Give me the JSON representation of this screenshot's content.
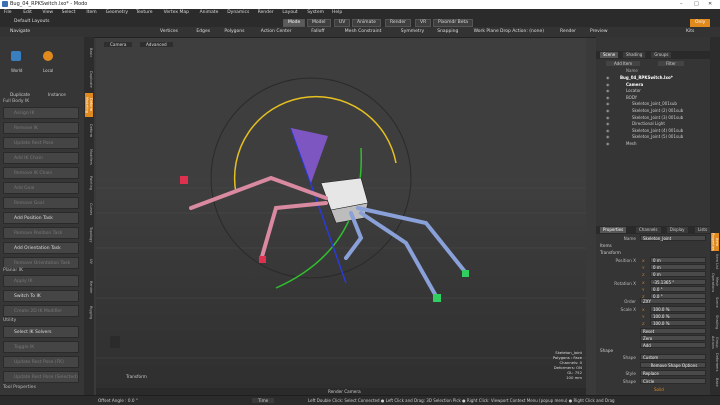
{
  "window": {
    "title": "Bug_04_RPKSwitch.lxo* - Modo",
    "controls": [
      "–",
      "□",
      "✕"
    ]
  },
  "menu": [
    "File",
    "Edit",
    "View",
    "Select",
    "Item",
    "Geometry",
    "Texture",
    "Vertex Map",
    "Animate",
    "Dynamics",
    "Render",
    "Layout",
    "System",
    "Help"
  ],
  "layout_selector": "Default Layouts",
  "mode_tabs": [
    {
      "label": "Mode",
      "active": true
    },
    {
      "label": "Model",
      "active": false
    },
    {
      "label": "UV",
      "active": false
    },
    {
      "label": "Animate",
      "active": false
    },
    {
      "label": "Render",
      "active": false
    },
    {
      "label": "VR",
      "active": false
    },
    {
      "label": "Pixomdr Beta",
      "active": false
    }
  ],
  "only_label": "Only",
  "toolbar": {
    "navigate": "Navigate",
    "items": [
      "Vertices",
      "Edges",
      "Polygons",
      "Action Center",
      "Falloff",
      "Mesh Constraint",
      "Symmetry",
      "Snapping",
      "Work Plane"
    ],
    "drop_action": "Drop Action: (none)",
    "render": "Render",
    "preview": "Preview",
    "kits": "Kits"
  },
  "left": {
    "tool_icons": [
      "World",
      "Local"
    ],
    "blend": [
      "Duplicate",
      "Instance"
    ],
    "section_title": "Full Body IK",
    "tools": [
      {
        "label": "Assign IK",
        "dim": true
      },
      {
        "label": "Remove IK",
        "dim": true
      },
      {
        "label": "Update Rest Pose",
        "dim": true
      },
      {
        "label": "Add IK Chain",
        "dim": true
      },
      {
        "label": "Remove IK Chain",
        "dim": true
      },
      {
        "label": "Add Goal",
        "dim": true
      },
      {
        "label": "Remove Goal",
        "dim": true
      },
      {
        "label": "Add Position Task",
        "dim": false
      },
      {
        "label": "Remove Position Task",
        "dim": true
      },
      {
        "label": "Add Orientation Task",
        "dim": false
      },
      {
        "label": "Remove Orientation Task",
        "dim": true
      }
    ],
    "planar_title": "Planar IK",
    "planar_tools": [
      {
        "label": "Apply IK",
        "dim": true
      },
      {
        "label": "Switch To IK",
        "dim": false
      },
      {
        "label": "Create 2D IK Modifier",
        "dim": true
      }
    ],
    "utility_title": "Utility",
    "utility_tools": [
      {
        "label": "Select IK Solvers",
        "dim": false
      },
      {
        "label": "Toggle IK",
        "dim": true
      },
      {
        "label": "Update Rest Pose (FK)",
        "dim": true
      },
      {
        "label": "Update Rest Pose (Selected)",
        "dim": true
      }
    ],
    "tool_properties": "Tool Properties",
    "vertical_tabs": [
      "Basic",
      "Duplicate",
      "Deform Modeling",
      "Deform",
      "Modifiers",
      "Painting",
      "Curves",
      "Topology",
      "UV",
      "Render",
      "Rigging"
    ]
  },
  "viewport": {
    "camera": "Camera",
    "shading": "Advanced",
    "info_lines": [
      "Skeleton_Joint",
      "Polygons : Face",
      "Channels: 0",
      "Deformers: ON",
      "GL: 752",
      "100 mm"
    ],
    "transform_label": "Transform",
    "view_label": "Render Camera"
  },
  "status": {
    "offset": "Offset Angle : 0.0 °",
    "time": "Time",
    "hints": "Left Double Click: Select Connected  ● Left Click and Drag: 3D Selection Pick  ● Right Click: Viewport Context Menu (popup menu)  ● Right Click and Drag"
  },
  "scene": {
    "tabs": [
      {
        "label": "Scene",
        "active": true
      },
      {
        "label": "Shading",
        "active": false
      },
      {
        "label": "Groups",
        "active": false
      }
    ],
    "add_item": "Add Item",
    "filter": "Filter",
    "column": "Name",
    "tree": [
      {
        "label": "Bug_04_RPKSwitch.lxo*",
        "indent": 0,
        "bold": true
      },
      {
        "label": "Camera",
        "indent": 1,
        "bold": true
      },
      {
        "label": "Locator",
        "indent": 1,
        "bold": false
      },
      {
        "label": "BODY",
        "indent": 1,
        "bold": false
      },
      {
        "label": "Skeleton_Joint_001sub",
        "indent": 2,
        "bold": false
      },
      {
        "label": "Skeleton_Joint (2) 001sub",
        "indent": 2,
        "bold": false
      },
      {
        "label": "Skeleton_Joint (3) 001sub",
        "indent": 2,
        "bold": false
      },
      {
        "label": "Directional Light",
        "indent": 2,
        "bold": false
      },
      {
        "label": "Skeleton_Joint (4) 001sub",
        "indent": 2,
        "bold": false
      },
      {
        "label": "Skeleton_Joint (5) 001sub",
        "indent": 2,
        "bold": false
      },
      {
        "label": "Mesh",
        "indent": 1,
        "bold": false
      }
    ]
  },
  "properties": {
    "tabs": [
      {
        "label": "Properties",
        "active": true
      },
      {
        "label": "Channels",
        "active": false
      },
      {
        "label": "Display",
        "active": false
      },
      {
        "label": "Lists",
        "active": false
      }
    ],
    "name_label": "Name",
    "name_value": "Skeleton_Joint",
    "section_transform": "Transform",
    "section_items": "Items",
    "position_label": "Position X",
    "position": [
      "0 m",
      "0 m",
      "0 m"
    ],
    "rotation_label": "Rotation X",
    "rotation": [
      "-35.1365 °",
      "0.0 °",
      "0.0 °"
    ],
    "order_label": "Order",
    "order": "ZXY",
    "scale_label": "Scale X",
    "scale": [
      "100.0 %",
      "100.0 %",
      "100.0 %"
    ],
    "axes": [
      "X",
      "Y",
      "Z"
    ],
    "buttons": [
      "Reset",
      "Zero",
      "Add"
    ],
    "section_shape": "Shape",
    "shape_label": "Shape",
    "shape_value": "Custom",
    "shape_button": "Remove Shape Options",
    "style_label": "Style",
    "style_value": "Replace",
    "shape2_label": "Shape",
    "shape2_value": "Circle",
    "solid": "Solid",
    "command": "Command"
  },
  "right_vtabs": [
    "Item Properties",
    "Item List",
    "Mesh Operations",
    "Scene",
    "Shading",
    "Group Actions",
    "Deformers",
    "Bake"
  ],
  "colors": {
    "accent": "#e08a1e",
    "gizmo_ring": "#e6c020",
    "gizmo_green": "#2fbf2f",
    "gizmo_blue": "#2a3ad8",
    "gizmo_violet": "#8a5ad8",
    "leg_pink": "#d98aa0",
    "leg_blue": "#8aa0d9",
    "target_red": "#e03050",
    "target_green": "#30d060"
  }
}
